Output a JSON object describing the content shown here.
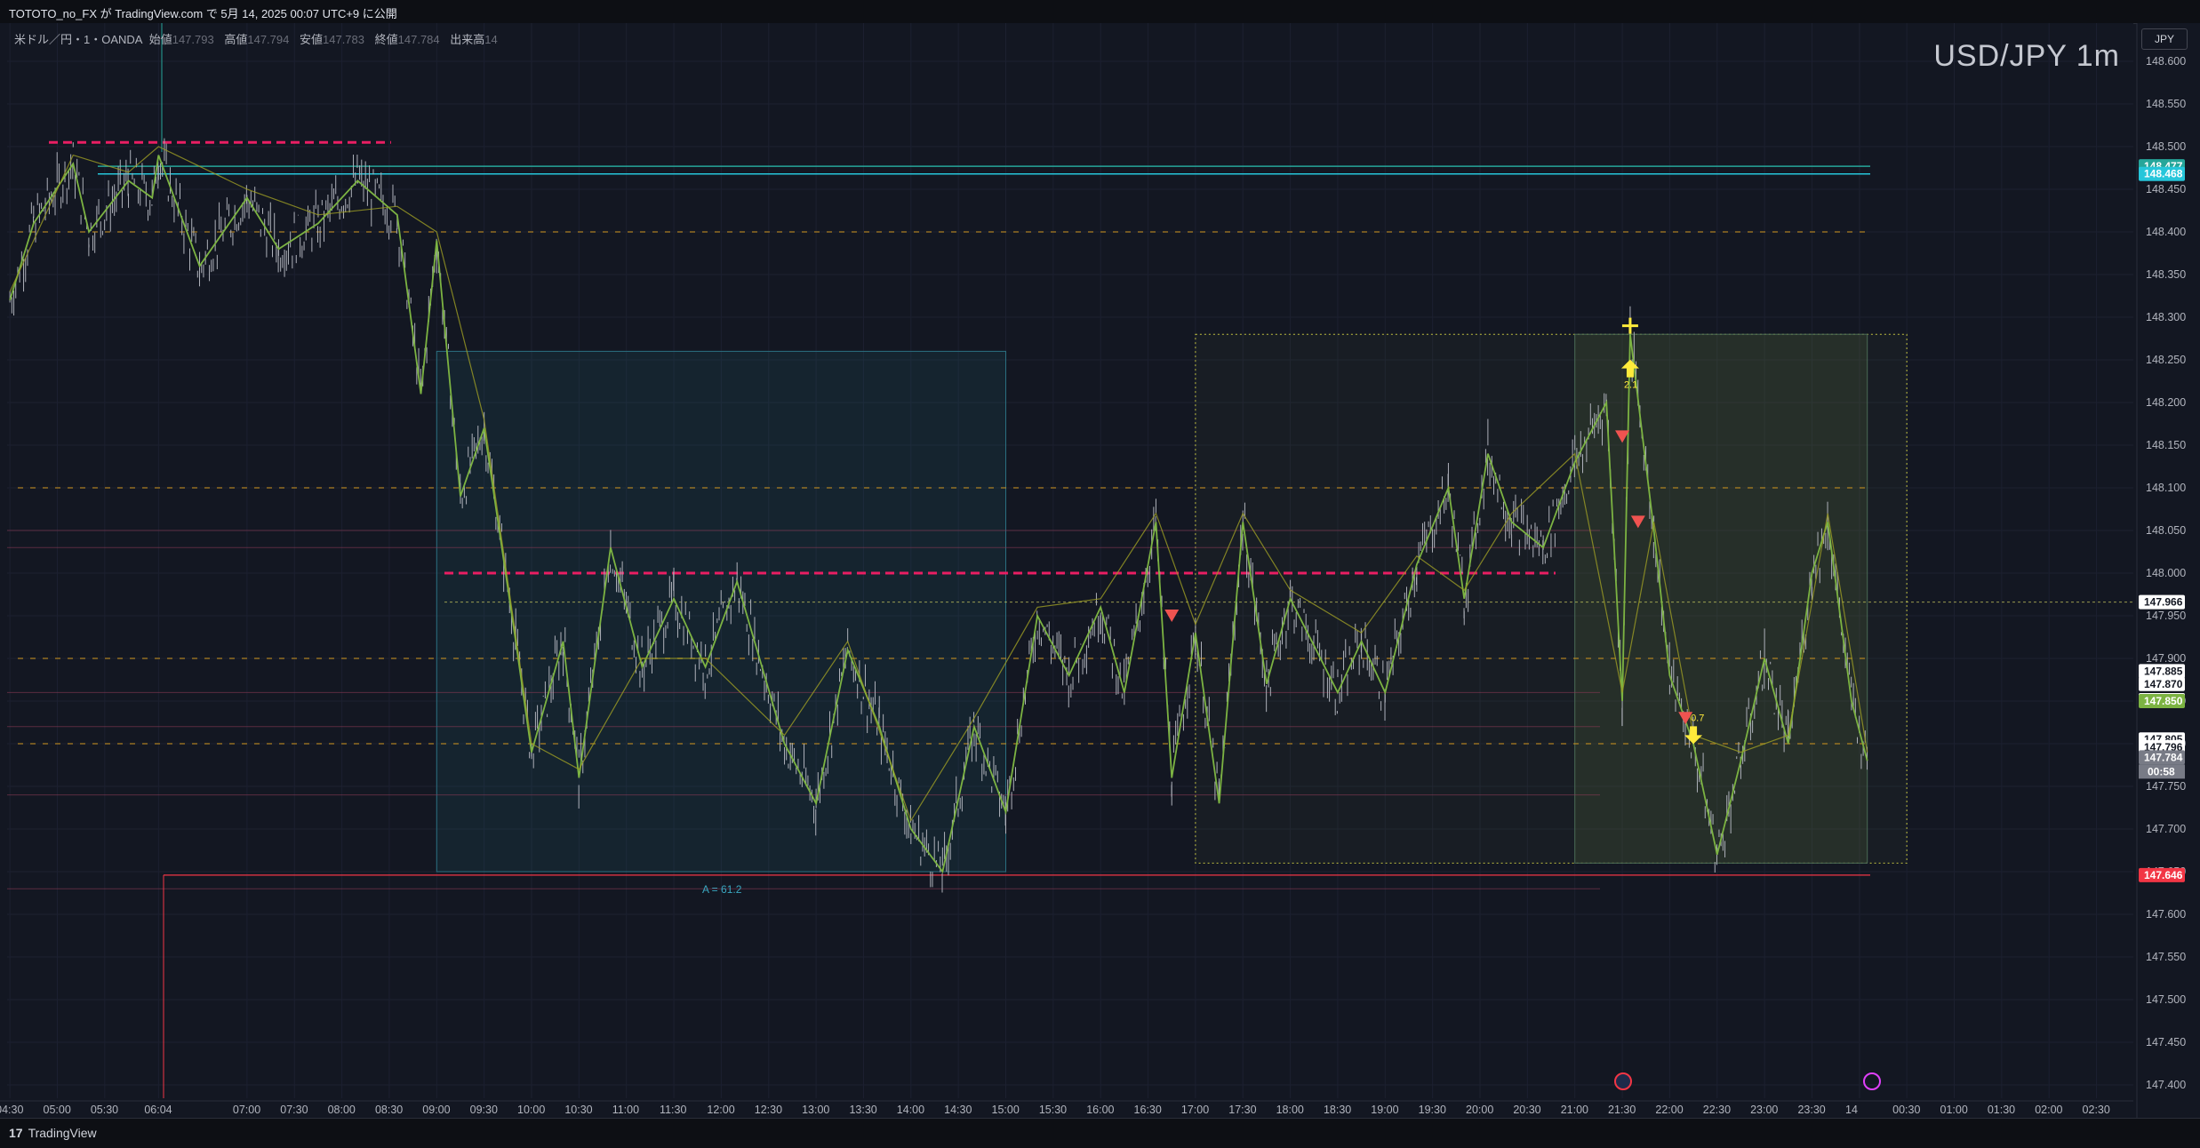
{
  "header": {
    "publish_line": "TOTOTO_no_FX が TradingView.com で 5月 14, 2025 00:07 UTC+9 に公開"
  },
  "ohlc": {
    "symbol": "米ドル／円・1・OANDA",
    "open_label": "始値",
    "open": "147.793",
    "high_label": "高値",
    "high": "147.794",
    "low_label": "安値",
    "low": "147.783",
    "close_label": "終値",
    "close": "147.784",
    "volume_label": "出来高",
    "volume": "14"
  },
  "watermark": "USD/JPY 1m",
  "currency_button": "JPY",
  "footer": {
    "brand_mark": "17",
    "brand": "TradingView"
  },
  "annotation_a": "A = 61.2",
  "signal_labels": {
    "up": "2.1",
    "down": "0.7"
  },
  "countdown": "00:58",
  "colors": {
    "background": "#131722",
    "candle": "#b2b5be",
    "zigzag": "#7cb342",
    "orange_level": "#c8901e",
    "pink_level": "#e91e63",
    "cyan_level": "#26c6da",
    "teal_box": "#1e4d5c",
    "green_box": "#2e3b2a",
    "up_arrow": "#ffeb3b",
    "down_arrow": "#ef5350"
  },
  "chart_data": {
    "type": "line",
    "title": "USD/JPY 1m",
    "ylim": [
      147.37,
      148.64
    ],
    "y_ticks": [
      "148.600",
      "148.550",
      "148.500",
      "148.450",
      "148.400",
      "148.350",
      "148.300",
      "148.250",
      "148.200",
      "148.150",
      "148.100",
      "148.050",
      "148.000",
      "147.950",
      "147.900",
      "147.850",
      "147.800",
      "147.750",
      "147.700",
      "147.650",
      "147.600",
      "147.550",
      "147.500",
      "147.450",
      "147.400"
    ],
    "x_ticks": [
      "04:30",
      "05:00",
      "05:30",
      "06:04",
      "07:00",
      "07:30",
      "08:00",
      "08:30",
      "09:00",
      "09:30",
      "10:00",
      "10:30",
      "11:00",
      "11:30",
      "12:00",
      "12:30",
      "13:00",
      "13:30",
      "14:00",
      "14:30",
      "15:00",
      "15:30",
      "16:00",
      "16:30",
      "17:00",
      "17:30",
      "18:00",
      "18:30",
      "19:00",
      "19:30",
      "20:00",
      "20:30",
      "21:00",
      "21:30",
      "22:00",
      "22:30",
      "23:00",
      "23:30",
      "14",
      "00:30",
      "01:00",
      "01:30",
      "02:00",
      "02:30"
    ],
    "price_path": [
      {
        "t": "04:30",
        "p": 148.32
      },
      {
        "t": "04:45",
        "p": 148.41
      },
      {
        "t": "05:10",
        "p": 148.48
      },
      {
        "t": "05:20",
        "p": 148.4
      },
      {
        "t": "05:45",
        "p": 148.46
      },
      {
        "t": "06:00",
        "p": 148.44
      },
      {
        "t": "06:04",
        "p": 148.49
      },
      {
        "t": "06:30",
        "p": 148.36
      },
      {
        "t": "07:00",
        "p": 148.44
      },
      {
        "t": "07:20",
        "p": 148.38
      },
      {
        "t": "07:45",
        "p": 148.41
      },
      {
        "t": "08:10",
        "p": 148.46
      },
      {
        "t": "08:35",
        "p": 148.42
      },
      {
        "t": "08:50",
        "p": 148.21
      },
      {
        "t": "09:00",
        "p": 148.39
      },
      {
        "t": "09:15",
        "p": 148.09
      },
      {
        "t": "09:30",
        "p": 148.17
      },
      {
        "t": "09:50",
        "p": 147.92
      },
      {
        "t": "10:00",
        "p": 147.79
      },
      {
        "t": "10:20",
        "p": 147.92
      },
      {
        "t": "10:30",
        "p": 147.76
      },
      {
        "t": "10:50",
        "p": 148.03
      },
      {
        "t": "11:10",
        "p": 147.89
      },
      {
        "t": "11:30",
        "p": 147.97
      },
      {
        "t": "11:50",
        "p": 147.89
      },
      {
        "t": "12:10",
        "p": 147.99
      },
      {
        "t": "12:40",
        "p": 147.8
      },
      {
        "t": "13:00",
        "p": 147.73
      },
      {
        "t": "13:20",
        "p": 147.91
      },
      {
        "t": "13:40",
        "p": 147.82
      },
      {
        "t": "14:00",
        "p": 147.7
      },
      {
        "t": "14:20",
        "p": 147.65
      },
      {
        "t": "14:40",
        "p": 147.82
      },
      {
        "t": "15:00",
        "p": 147.72
      },
      {
        "t": "15:20",
        "p": 147.95
      },
      {
        "t": "15:40",
        "p": 147.88
      },
      {
        "t": "16:00",
        "p": 147.96
      },
      {
        "t": "16:15",
        "p": 147.86
      },
      {
        "t": "16:35",
        "p": 148.06
      },
      {
        "t": "16:45",
        "p": 147.76
      },
      {
        "t": "17:00",
        "p": 147.93
      },
      {
        "t": "17:15",
        "p": 147.73
      },
      {
        "t": "17:30",
        "p": 148.06
      },
      {
        "t": "17:45",
        "p": 147.87
      },
      {
        "t": "18:00",
        "p": 147.97
      },
      {
        "t": "18:30",
        "p": 147.86
      },
      {
        "t": "18:45",
        "p": 147.92
      },
      {
        "t": "19:00",
        "p": 147.86
      },
      {
        "t": "19:20",
        "p": 148.01
      },
      {
        "t": "19:40",
        "p": 148.1
      },
      {
        "t": "19:50",
        "p": 147.97
      },
      {
        "t": "20:05",
        "p": 148.14
      },
      {
        "t": "20:20",
        "p": 148.06
      },
      {
        "t": "20:40",
        "p": 148.03
      },
      {
        "t": "21:00",
        "p": 148.13
      },
      {
        "t": "21:20",
        "p": 148.2
      },
      {
        "t": "21:30",
        "p": 147.85
      },
      {
        "t": "21:35",
        "p": 148.28
      },
      {
        "t": "21:50",
        "p": 148.05
      },
      {
        "t": "22:00",
        "p": 147.88
      },
      {
        "t": "22:15",
        "p": 147.8
      },
      {
        "t": "22:30",
        "p": 147.67
      },
      {
        "t": "22:45",
        "p": 147.78
      },
      {
        "t": "23:00",
        "p": 147.9
      },
      {
        "t": "23:15",
        "p": 147.8
      },
      {
        "t": "23:30",
        "p": 148.0
      },
      {
        "t": "23:40",
        "p": 148.06
      },
      {
        "t": "23:55",
        "p": 147.85
      },
      {
        "t": "00:05",
        "p": 147.78
      }
    ],
    "horizontal_levels": [
      {
        "price": 148.477,
        "label": "148.477",
        "color": "#26a69a"
      },
      {
        "price": 148.468,
        "label": "148.468",
        "color": "#26c6da"
      },
      {
        "price": 147.966,
        "label": "147.966",
        "color": "#ffffff"
      },
      {
        "price": 147.885,
        "label": "147.885",
        "color": "#ffffff"
      },
      {
        "price": 147.87,
        "label": "147.870",
        "color": "#ffffff"
      },
      {
        "price": 147.851,
        "label": "147.851",
        "color": "#ffffff"
      },
      {
        "price": 147.85,
        "label": "147.850",
        "color": "#7cb342"
      },
      {
        "price": 147.805,
        "label": "147.805",
        "color": "#ffffff"
      },
      {
        "price": 147.796,
        "label": "147.796",
        "color": "#ffffff"
      },
      {
        "price": 147.784,
        "label": "147.784",
        "color": "#d1d4dc"
      },
      {
        "price": 147.646,
        "label": "147.646",
        "color": "#f23645"
      }
    ],
    "boxes": [
      {
        "from": "09:00",
        "to": "15:00",
        "top": 148.26,
        "bottom": 147.65,
        "kind": "teal"
      },
      {
        "from": "17:00",
        "to": "00:30",
        "top": 148.28,
        "bottom": 147.66,
        "kind": "dotted-yellow"
      },
      {
        "from": "21:00",
        "to": "00:05",
        "top": 148.28,
        "bottom": 147.66,
        "kind": "green"
      }
    ]
  }
}
